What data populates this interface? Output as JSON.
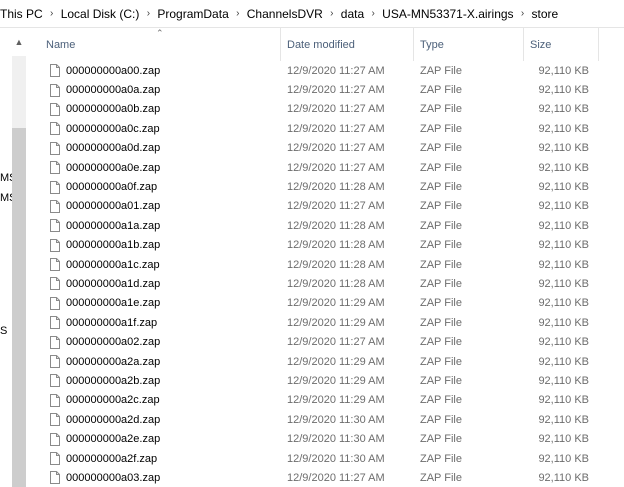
{
  "breadcrumb": [
    "This PC",
    "Local Disk (C:)",
    "ProgramData",
    "ChannelsDVR",
    "data",
    "USA-MN53371-X.airings",
    "store"
  ],
  "navpane": {
    "fragments": [
      "MS",
      "MS",
      "S"
    ],
    "scroll_up_icon": "chevron-up-icon"
  },
  "columns": {
    "name": "Name",
    "date": "Date modified",
    "type": "Type",
    "size": "Size"
  },
  "files": [
    {
      "name": "000000000a00.zap",
      "date": "12/9/2020 11:27 AM",
      "type": "ZAP File",
      "size": "92,110 KB"
    },
    {
      "name": "000000000a0a.zap",
      "date": "12/9/2020 11:27 AM",
      "type": "ZAP File",
      "size": "92,110 KB"
    },
    {
      "name": "000000000a0b.zap",
      "date": "12/9/2020 11:27 AM",
      "type": "ZAP File",
      "size": "92,110 KB"
    },
    {
      "name": "000000000a0c.zap",
      "date": "12/9/2020 11:27 AM",
      "type": "ZAP File",
      "size": "92,110 KB"
    },
    {
      "name": "000000000a0d.zap",
      "date": "12/9/2020 11:27 AM",
      "type": "ZAP File",
      "size": "92,110 KB"
    },
    {
      "name": "000000000a0e.zap",
      "date": "12/9/2020 11:27 AM",
      "type": "ZAP File",
      "size": "92,110 KB"
    },
    {
      "name": "000000000a0f.zap",
      "date": "12/9/2020 11:28 AM",
      "type": "ZAP File",
      "size": "92,110 KB"
    },
    {
      "name": "000000000a01.zap",
      "date": "12/9/2020 11:27 AM",
      "type": "ZAP File",
      "size": "92,110 KB"
    },
    {
      "name": "000000000a1a.zap",
      "date": "12/9/2020 11:28 AM",
      "type": "ZAP File",
      "size": "92,110 KB"
    },
    {
      "name": "000000000a1b.zap",
      "date": "12/9/2020 11:28 AM",
      "type": "ZAP File",
      "size": "92,110 KB"
    },
    {
      "name": "000000000a1c.zap",
      "date": "12/9/2020 11:28 AM",
      "type": "ZAP File",
      "size": "92,110 KB"
    },
    {
      "name": "000000000a1d.zap",
      "date": "12/9/2020 11:28 AM",
      "type": "ZAP File",
      "size": "92,110 KB"
    },
    {
      "name": "000000000a1e.zap",
      "date": "12/9/2020 11:29 AM",
      "type": "ZAP File",
      "size": "92,110 KB"
    },
    {
      "name": "000000000a1f.zap",
      "date": "12/9/2020 11:29 AM",
      "type": "ZAP File",
      "size": "92,110 KB"
    },
    {
      "name": "000000000a02.zap",
      "date": "12/9/2020 11:27 AM",
      "type": "ZAP File",
      "size": "92,110 KB"
    },
    {
      "name": "000000000a2a.zap",
      "date": "12/9/2020 11:29 AM",
      "type": "ZAP File",
      "size": "92,110 KB"
    },
    {
      "name": "000000000a2b.zap",
      "date": "12/9/2020 11:29 AM",
      "type": "ZAP File",
      "size": "92,110 KB"
    },
    {
      "name": "000000000a2c.zap",
      "date": "12/9/2020 11:29 AM",
      "type": "ZAP File",
      "size": "92,110 KB"
    },
    {
      "name": "000000000a2d.zap",
      "date": "12/9/2020 11:30 AM",
      "type": "ZAP File",
      "size": "92,110 KB"
    },
    {
      "name": "000000000a2e.zap",
      "date": "12/9/2020 11:30 AM",
      "type": "ZAP File",
      "size": "92,110 KB"
    },
    {
      "name": "000000000a2f.zap",
      "date": "12/9/2020 11:30 AM",
      "type": "ZAP File",
      "size": "92,110 KB"
    },
    {
      "name": "000000000a03.zap",
      "date": "12/9/2020 11:27 AM",
      "type": "ZAP File",
      "size": "92,110 KB"
    }
  ],
  "icons": {
    "file": "file-icon",
    "sort": "sort-ascending-icon",
    "separator": "chevron-right-icon"
  },
  "colors": {
    "header_text": "#4c607a",
    "secondary_text": "#6d6d6d",
    "divider": "#e5e5e5"
  }
}
